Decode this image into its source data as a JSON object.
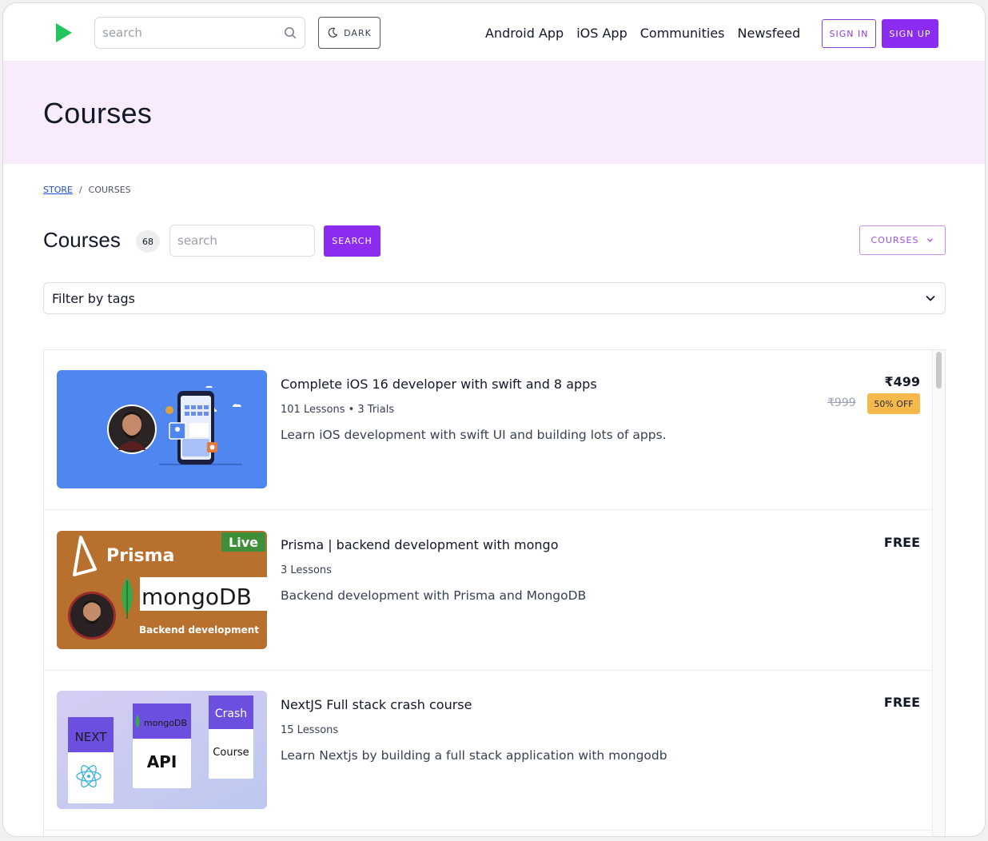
{
  "header": {
    "search_placeholder": "search",
    "dark_label": "DARK",
    "nav": [
      "Android App",
      "iOS App",
      "Communities",
      "Newsfeed"
    ],
    "signin_label": "SIGN IN",
    "signup_label": "SIGN UP"
  },
  "hero": {
    "title": "Courses"
  },
  "breadcrumb": {
    "store": "STORE",
    "separator": "/",
    "current": "COURSES"
  },
  "toolbar": {
    "title": "Courses",
    "count": "68",
    "search_placeholder": "search",
    "search_label": "SEARCH",
    "type_selected": "COURSES"
  },
  "filter": {
    "label": "Filter by tags"
  },
  "courses": [
    {
      "title": "Complete iOS 16 developer with swift and 8 apps",
      "meta": "101 Lessons • 3 Trials",
      "description": "Learn iOS development with swift UI and building lots of apps.",
      "price": "₹499",
      "old_price": "₹999",
      "discount": "50% OFF"
    },
    {
      "title": "Prisma | backend development with mongo",
      "meta": "3 Lessons",
      "description": "Backend development with Prisma and MongoDB",
      "price": "FREE",
      "thumb_brand": "Prisma",
      "thumb_badge": "Live",
      "thumb_db": "mongoDB",
      "thumb_caption": "Backend development"
    },
    {
      "title": "NextJS Full stack crash course",
      "meta": "15 Lessons",
      "description": "Learn Nextjs by building a full stack application with mongodb",
      "price": "FREE",
      "thumb_next": "NEXT",
      "thumb_db": "mongoDB",
      "thumb_api": "API",
      "thumb_crash": "Crash",
      "thumb_course": "Course"
    }
  ],
  "colors": {
    "accent": "#8b2cf0",
    "logo": "#22c55e",
    "hero_bg": "#f8ecfc",
    "discount": "#f5b84a"
  }
}
